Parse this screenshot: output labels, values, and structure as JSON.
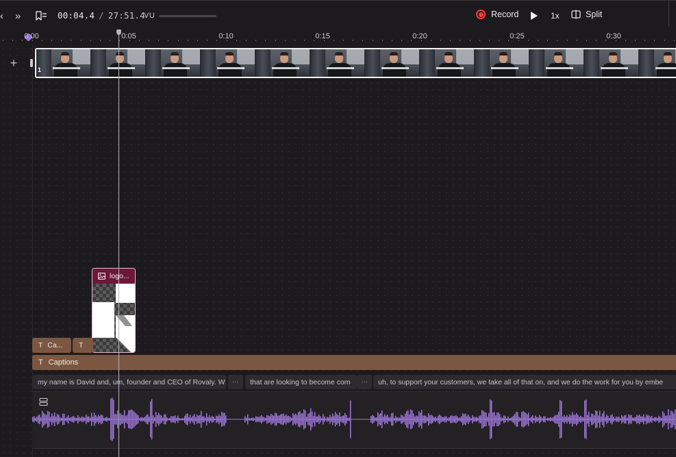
{
  "toolbar": {
    "prev_label": "‹",
    "next_label": "»",
    "current_time": "00:04.4",
    "separator": "/",
    "total_time": "27:51.4",
    "vu_label": "VU",
    "record_label": "Record",
    "speed_label": "1x",
    "split_label": "Split"
  },
  "ruler": {
    "ticks": [
      "0:00",
      "0:05",
      "0:10",
      "0:15",
      "0:20",
      "0:25",
      "0:30"
    ]
  },
  "tracks": {
    "add_label": "+",
    "video_clip": {
      "index_label": "1",
      "frame_count": 12
    },
    "logo_clip": {
      "label": "logo..."
    },
    "caption_chips": [
      {
        "label": "Ca..."
      },
      {
        "label": ""
      }
    ],
    "captions_label": "Captions",
    "transcript": [
      {
        "text": "my name is David and, um, founder and CEO of Rovaly. W"
      },
      {
        "text": "that are looking to become com"
      },
      {
        "text": "uh, to support your customers, we take all of that on, and we do the work for you by embe"
      }
    ],
    "gap_label": "···"
  },
  "colors": {
    "accent_purple": "#9b6fe0",
    "waveform": "#a77de6",
    "record_red": "#ff3b3b",
    "caption_brown": "#7b5742",
    "logo_header": "#6d1837"
  }
}
